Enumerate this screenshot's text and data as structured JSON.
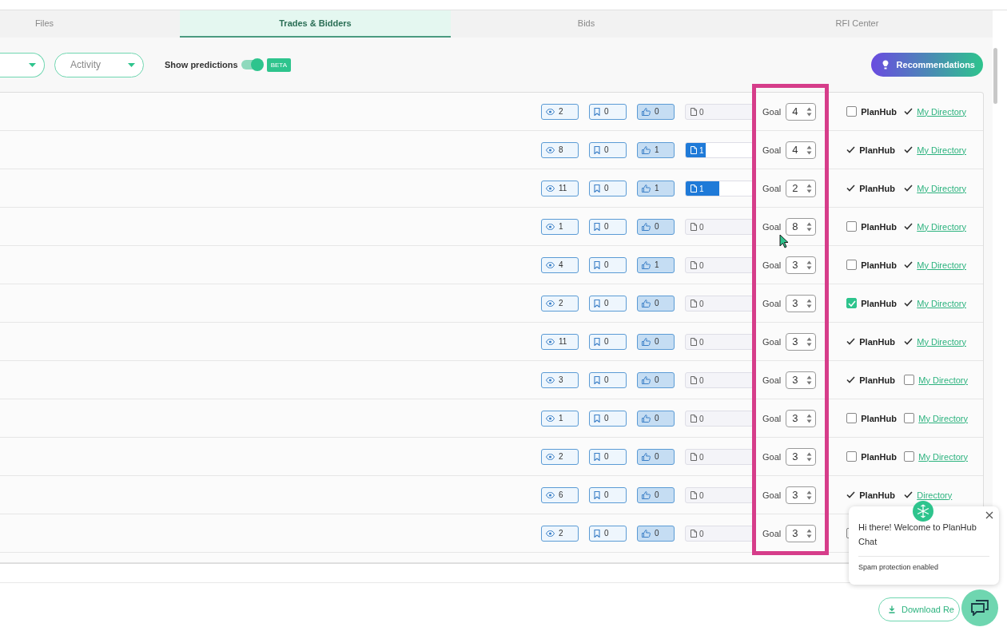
{
  "tabs": [
    {
      "label": "Files",
      "selected": false
    },
    {
      "label": "Trades & Bidders",
      "selected": true
    },
    {
      "label": "Bids",
      "selected": false
    },
    {
      "label": "RFI Center",
      "selected": false
    }
  ],
  "filters": [
    {
      "kind": "cut"
    },
    {
      "kind": "full",
      "label": "Activity"
    }
  ],
  "predictions": {
    "label": "Show predictions",
    "on": true,
    "badge": "BETA"
  },
  "recommendations": {
    "label": "Recommendations"
  },
  "rows": [
    {
      "views": "2",
      "saves": "0",
      "likes": "0",
      "docs": "0",
      "level": 0,
      "goal_label": "Goal",
      "goal": "4",
      "planhub": {
        "kind": "checkbox",
        "checked": false,
        "label": "PlanHub"
      },
      "directory": {
        "kind": "tick",
        "label": "My Directory"
      }
    },
    {
      "views": "8",
      "saves": "0",
      "likes": "1",
      "docs": "1",
      "level": 0.3,
      "goal_label": "Goal",
      "goal": "4",
      "planhub": {
        "kind": "tick",
        "label": "PlanHub"
      },
      "directory": {
        "kind": "tick",
        "label": "My Directory"
      }
    },
    {
      "views": "11",
      "saves": "0",
      "likes": "1",
      "docs": "1",
      "level": 0.5,
      "goal_label": "Goal",
      "goal": "2",
      "planhub": {
        "kind": "tick",
        "label": "PlanHub"
      },
      "directory": {
        "kind": "tick",
        "label": "My Directory"
      }
    },
    {
      "views": "1",
      "saves": "0",
      "likes": "0",
      "docs": "0",
      "level": 0,
      "goal_label": "Goal",
      "goal": "8",
      "planhub": {
        "kind": "checkbox",
        "checked": false,
        "label": "PlanHub"
      },
      "directory": {
        "kind": "tick",
        "label": "My Directory"
      }
    },
    {
      "views": "4",
      "saves": "0",
      "likes": "1",
      "docs": "0",
      "level": 0,
      "goal_label": "Goal",
      "goal": "3",
      "planhub": {
        "kind": "checkbox",
        "checked": false,
        "label": "PlanHub"
      },
      "directory": {
        "kind": "tick",
        "label": "My Directory"
      }
    },
    {
      "views": "2",
      "saves": "0",
      "likes": "0",
      "docs": "0",
      "level": 0,
      "goal_label": "Goal",
      "goal": "3",
      "planhub": {
        "kind": "checkbox",
        "checked": true,
        "label": "PlanHub"
      },
      "directory": {
        "kind": "tick",
        "label": "My Directory"
      }
    },
    {
      "views": "11",
      "saves": "0",
      "likes": "0",
      "docs": "0",
      "level": 0,
      "goal_label": "Goal",
      "goal": "3",
      "planhub": {
        "kind": "tick",
        "label": "PlanHub"
      },
      "directory": {
        "kind": "tick",
        "label": "My Directory"
      }
    },
    {
      "views": "3",
      "saves": "0",
      "likes": "0",
      "docs": "0",
      "level": 0,
      "goal_label": "Goal",
      "goal": "3",
      "planhub": {
        "kind": "tick",
        "label": "PlanHub"
      },
      "directory": {
        "kind": "checkbox",
        "checked": false,
        "label": "My Directory"
      }
    },
    {
      "views": "1",
      "saves": "0",
      "likes": "0",
      "docs": "0",
      "level": 0,
      "goal_label": "Goal",
      "goal": "3",
      "planhub": {
        "kind": "checkbox",
        "checked": false,
        "label": "PlanHub"
      },
      "directory": {
        "kind": "checkbox",
        "checked": false,
        "label": "My Directory"
      }
    },
    {
      "views": "2",
      "saves": "0",
      "likes": "0",
      "docs": "0",
      "level": 0,
      "goal_label": "Goal",
      "goal": "3",
      "planhub": {
        "kind": "checkbox",
        "checked": false,
        "label": "PlanHub"
      },
      "directory": {
        "kind": "checkbox",
        "checked": false,
        "label": "My Directory"
      }
    },
    {
      "views": "6",
      "saves": "0",
      "likes": "0",
      "docs": "0",
      "level": 0,
      "goal_label": "Goal",
      "goal": "3",
      "planhub": {
        "kind": "tick",
        "label": "PlanHub"
      },
      "directory": {
        "kind": "tick",
        "label": "Directory"
      }
    },
    {
      "views": "2",
      "saves": "0",
      "likes": "0",
      "docs": "0",
      "level": 0,
      "goal_label": "Goal",
      "goal": "3",
      "planhub": {
        "kind": "checkbox",
        "checked": false
      }
    }
  ],
  "download": {
    "label": "Download Re"
  },
  "chat": {
    "message": "Hi there! Welcome to PlanHub Chat",
    "note": "Spam protection enabled"
  }
}
